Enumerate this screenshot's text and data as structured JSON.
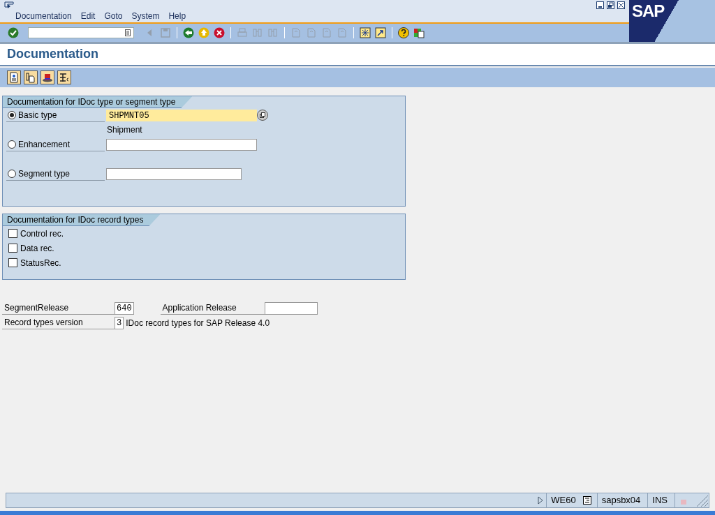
{
  "menu": [
    {
      "label": "Documentation"
    },
    {
      "label": "Edit"
    },
    {
      "label": "Goto"
    },
    {
      "label": "System"
    },
    {
      "label": "Help"
    }
  ],
  "logo": "SAP",
  "toolbar": [
    {
      "kind": "enter",
      "disabled": false
    },
    {
      "kind": "field"
    },
    {
      "kind": "prev",
      "disabled": true
    },
    {
      "kind": "save",
      "disabled": true
    },
    {
      "kind": "sep"
    },
    {
      "kind": "back",
      "disabled": false
    },
    {
      "kind": "exit",
      "disabled": false
    },
    {
      "kind": "cancel",
      "disabled": false
    },
    {
      "kind": "sep"
    },
    {
      "kind": "print",
      "disabled": true
    },
    {
      "kind": "find",
      "disabled": true
    },
    {
      "kind": "findnext",
      "disabled": true
    },
    {
      "kind": "sep"
    },
    {
      "kind": "first",
      "disabled": true
    },
    {
      "kind": "pageup",
      "disabled": true
    },
    {
      "kind": "pagedown",
      "disabled": true
    },
    {
      "kind": "last",
      "disabled": true
    },
    {
      "kind": "sep"
    },
    {
      "kind": "session",
      "disabled": false
    },
    {
      "kind": "shortcut",
      "disabled": false
    },
    {
      "kind": "sep"
    },
    {
      "kind": "help",
      "disabled": false
    },
    {
      "kind": "layout",
      "disabled": false
    }
  ],
  "title": "Documentation",
  "app_toolbar": [
    {
      "kind": "document"
    },
    {
      "kind": "copy"
    },
    {
      "kind": "hat"
    },
    {
      "kind": "structure"
    }
  ],
  "group_type": {
    "title": "Documentation for IDoc type or segment type",
    "options": [
      {
        "label": "Basic type",
        "selected": true,
        "value": "SHPMNT05",
        "description": "Shipment",
        "focused": true
      },
      {
        "label": "Enhancement",
        "selected": false,
        "focused": false
      },
      {
        "label": "Segment type",
        "selected": false,
        "focused": false
      }
    ]
  },
  "group_records": {
    "title": "Documentation for IDoc record types",
    "checkboxes": [
      {
        "label": "Control rec.",
        "checked": false
      },
      {
        "label": "Data rec.",
        "checked": false
      },
      {
        "label": "StatusRec.",
        "checked": false
      }
    ]
  },
  "segment_release": {
    "label": "SegmentRelease",
    "value": "640"
  },
  "application_release": {
    "label": "Application Release"
  },
  "record_types_version": {
    "label": "Record types version",
    "value": "3",
    "description": "IDoc record types for SAP Release 4.0"
  },
  "status_bar": {
    "transaction": "WE60",
    "server": "sapsbx04",
    "mode": "INS"
  }
}
